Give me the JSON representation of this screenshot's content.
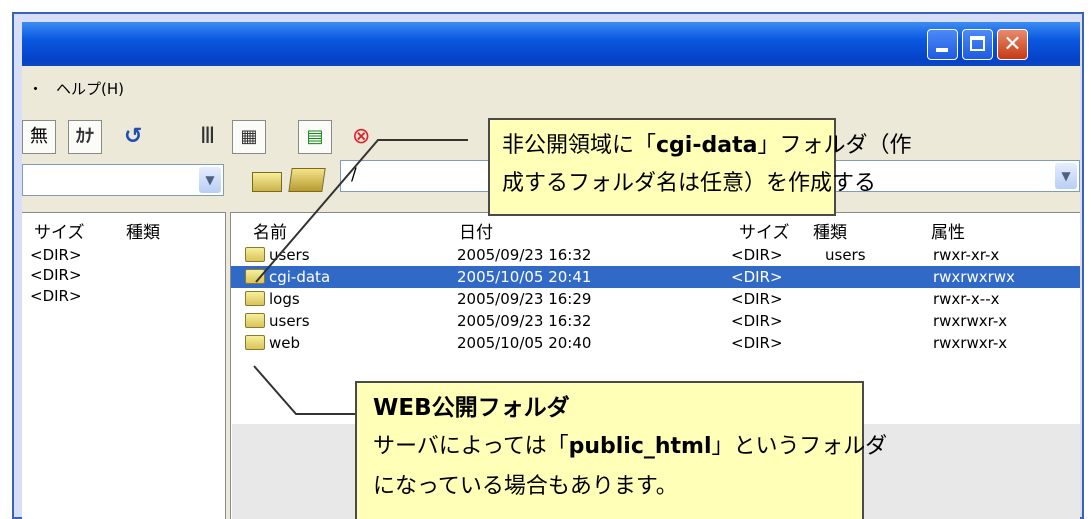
{
  "menu": {
    "help_label": "ヘルプ(H)",
    "partial_left": "・"
  },
  "toolbar": {
    "btn_muji": "無",
    "btn_kana": "ｶﾅ",
    "btn_refresh": "↺",
    "icon_list": "Ⅲ",
    "icon_grid": "▦",
    "icon_tree": "▤",
    "icon_stop": "⊗"
  },
  "remote_path": "/",
  "left_pane": {
    "columns": [
      "サイズ",
      "種類"
    ],
    "rows": [
      "<DIR>",
      "<DIR>",
      "<DIR>"
    ]
  },
  "right_pane": {
    "columns": [
      "名前",
      "日付",
      "サイズ",
      "種類",
      "属性"
    ],
    "rows": [
      {
        "name": "users",
        "date": "2005/09/23 16:32",
        "size": "<DIR>",
        "type": "users",
        "attr": "rwxr-xr-x"
      },
      {
        "name": "cgi-data",
        "date": "2005/10/05 20:41",
        "size": "<DIR>",
        "type": "",
        "attr": "rwxrwxrwx"
      },
      {
        "name": "logs",
        "date": "2005/09/23 16:29",
        "size": "<DIR>",
        "type": "",
        "attr": "rwxr-x--x"
      },
      {
        "name": "users",
        "date": "2005/09/23 16:32",
        "size": "<DIR>",
        "type": "",
        "attr": "rwxrwxr-x"
      },
      {
        "name": "web",
        "date": "2005/10/05 20:40",
        "size": "<DIR>",
        "type": "",
        "attr": "rwxrwxr-x"
      }
    ],
    "selected_index": 1
  },
  "callout_top": {
    "line1_a": "非公開領域に「",
    "line1_b": "cgi-data",
    "line1_c": "」フォルダ（作",
    "line2": "成するフォルダ名は任意）を作成する"
  },
  "callout_bottom": {
    "title": "WEB公開フォルダ",
    "line1_a": "サーバによっては「",
    "line1_b": "public_html",
    "line1_c": "」というフォルダ",
    "line2": "になっている場合もあります。"
  },
  "colors": {
    "titlebar": "#0a58e0",
    "selection": "#3169c6",
    "callout_bg": "#ffffb8"
  }
}
